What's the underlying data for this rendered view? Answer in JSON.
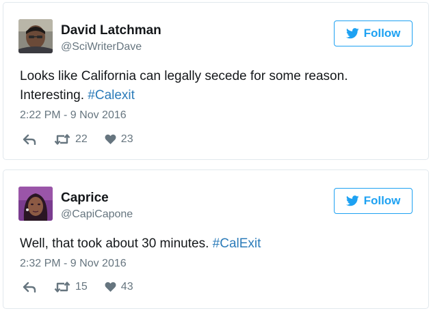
{
  "tweets": [
    {
      "display_name": "David Latchman",
      "handle": "@SciWriterDave",
      "follow_label": "Follow",
      "text_line1": "Looks like California can legally secede for some reason.",
      "text_line2_prefix": "Interesting.",
      "hashtag": "#Calexit",
      "timestamp": "2:22 PM - 9 Nov 2016",
      "retweets": "22",
      "likes": "23"
    },
    {
      "display_name": "Caprice",
      "handle": "@CapiCapone",
      "follow_label": "Follow",
      "text_prefix": "Well, that took about 30 minutes.",
      "hashtag": "#CalExit",
      "timestamp": "2:32 PM - 9 Nov 2016",
      "retweets": "15",
      "likes": "43"
    }
  ],
  "colors": {
    "accent": "#1da1f2",
    "hashtag": "#2b7bb9",
    "muted": "#66757f",
    "text": "#14171a",
    "border": "#e1e8ed"
  },
  "icons": [
    "twitter-bird-icon",
    "reply-icon",
    "retweet-icon",
    "heart-icon"
  ]
}
